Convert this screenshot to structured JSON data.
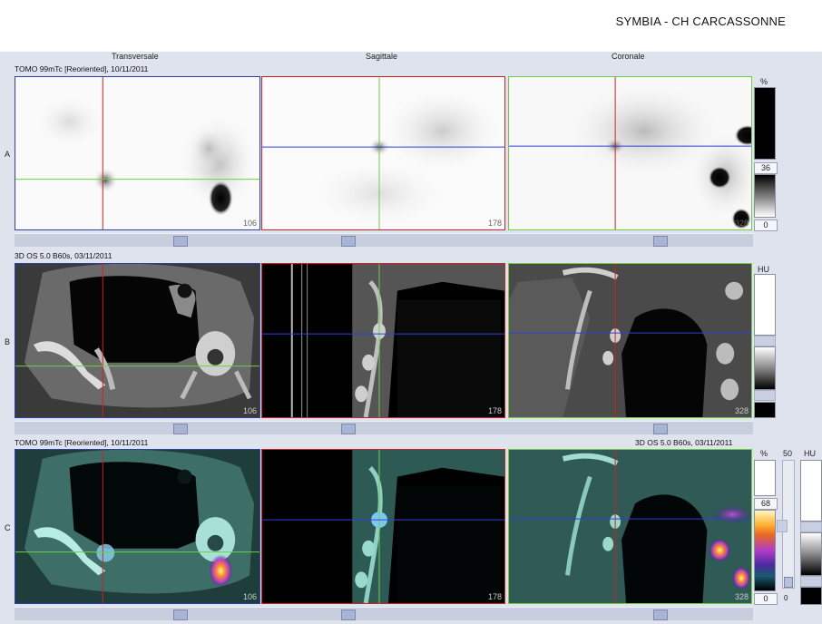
{
  "header": {
    "site": "SYMBIA - CH CARCASSONNE"
  },
  "columns": [
    "Transversale",
    "Sagittale",
    "Coronale"
  ],
  "rows": [
    {
      "label": "A",
      "series": "TOMO 99mTc [Reoriented], 10/11/2011",
      "slices": [
        "106",
        "178",
        "328"
      ]
    },
    {
      "label": "B",
      "series": "3D  OS  5.0  B60s, 03/11/2011",
      "slices": [
        "106",
        "178",
        "328"
      ]
    },
    {
      "label": "C",
      "series": "TOMO 99mTc [Reoriented], 10/11/2011",
      "series_right": "3D  OS  5.0  B60s, 03/11/2011",
      "slices": [
        "106",
        "178",
        "328"
      ]
    }
  ],
  "colorbars": {
    "a": {
      "unit": "%",
      "value": "36",
      "min": "0"
    },
    "b": {
      "unit": "HU"
    },
    "c": {
      "unit": "%",
      "value": "68",
      "min": "0",
      "level": "50",
      "unit2": "HU",
      "bottom": "0"
    }
  },
  "colors": {
    "crosshair_red": "#d42020",
    "crosshair_green": "#6cd23c",
    "crosshair_blue": "#3040d8",
    "frame_blue": "#2a3fb0"
  }
}
